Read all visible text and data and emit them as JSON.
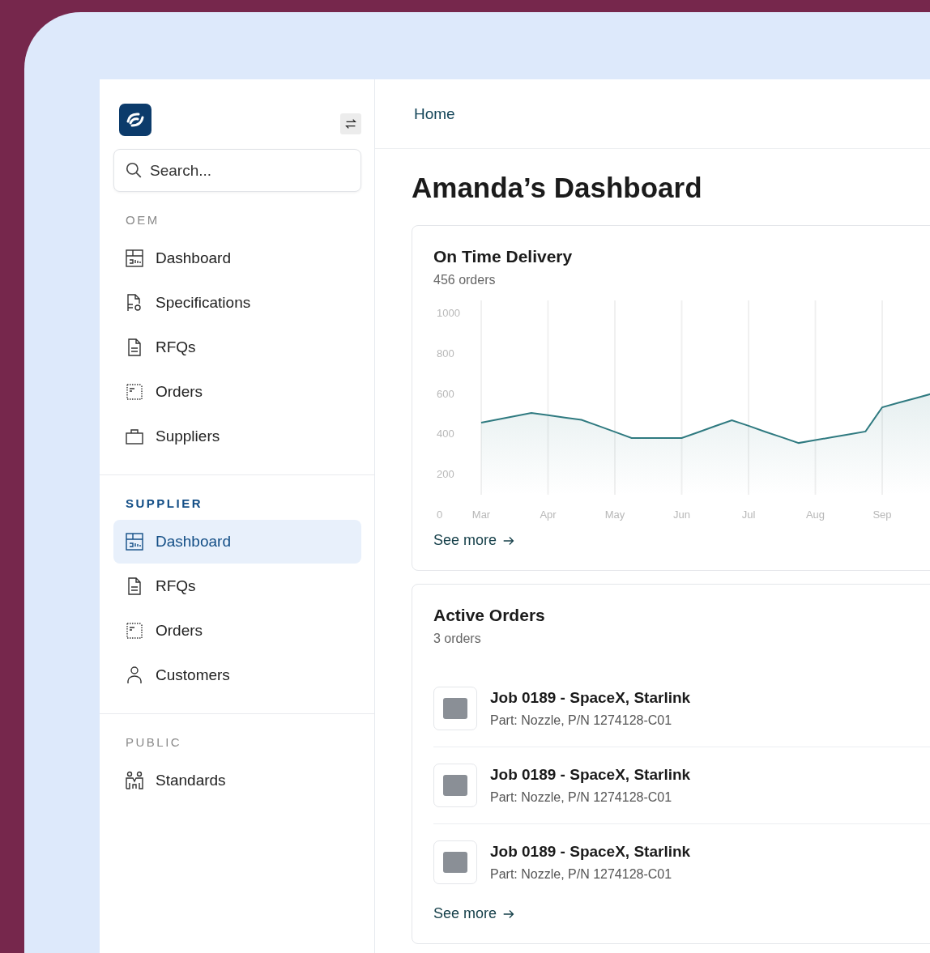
{
  "sidebar": {
    "search": {
      "placeholder": "Search..."
    },
    "sections": [
      {
        "heading": "OEM",
        "active": false,
        "items": [
          {
            "label": "Dashboard",
            "kind": "dashboard",
            "selected": false
          },
          {
            "label": "Specifications",
            "kind": "specs",
            "selected": false
          },
          {
            "label": "RFQs",
            "kind": "rfqs",
            "selected": false
          },
          {
            "label": "Orders",
            "kind": "orders",
            "selected": false
          },
          {
            "label": "Suppliers",
            "kind": "suppliers",
            "selected": false
          }
        ]
      },
      {
        "heading": "SUPPLIER",
        "active": true,
        "items": [
          {
            "label": "Dashboard",
            "kind": "dashboard",
            "selected": true
          },
          {
            "label": "RFQs",
            "kind": "rfqs",
            "selected": false
          },
          {
            "label": "Orders",
            "kind": "orders",
            "selected": false
          },
          {
            "label": "Customers",
            "kind": "customers",
            "selected": false
          }
        ]
      },
      {
        "heading": "PUBLIC",
        "active": false,
        "items": [
          {
            "label": "Standards",
            "kind": "standards",
            "selected": false
          }
        ]
      }
    ]
  },
  "breadcrumb": "Home",
  "title": "Amanda’s Dashboard",
  "delivery_card": {
    "title": "On Time Delivery",
    "subtitle": "456 orders",
    "link": "See more",
    "chart_data": {
      "type": "line",
      "grid": true,
      "categories": [
        "Mar",
        null,
        null,
        null,
        "Apr",
        null,
        null,
        null,
        "May",
        null,
        null,
        null,
        "Jun",
        null,
        null,
        null,
        "Jul",
        null,
        null,
        null,
        "Aug",
        null,
        null,
        null,
        "Sep",
        null,
        null,
        null
      ],
      "series": [
        {
          "color": "#2f7a80",
          "values": [
            454,
            470,
            486,
            502,
            491,
            479,
            468,
            438,
            408,
            378,
            378,
            378,
            378,
            407,
            437,
            466,
            438,
            409,
            381,
            353,
            367,
            382,
            396,
            410,
            530,
            553,
            575,
            598
          ]
        }
      ],
      "yticks": [
        0,
        200,
        400,
        600,
        800,
        1000
      ],
      "ylim": [
        0,
        1000
      ]
    }
  },
  "orders_card": {
    "title": "Active Orders",
    "subtitle": "3 orders",
    "link": "See more",
    "rows": [
      {
        "title": "Job 0189 - SpaceX, Starlink",
        "part": "Part: Nozzle, P/N 1274128-C01"
      },
      {
        "title": "Job 0189 - SpaceX, Starlink",
        "part": "Part: Nozzle, P/N 1274128-C01"
      },
      {
        "title": "Job 0189 - SpaceX, Starlink",
        "part": "Part: Nozzle, P/N 1274128-C01"
      }
    ]
  }
}
